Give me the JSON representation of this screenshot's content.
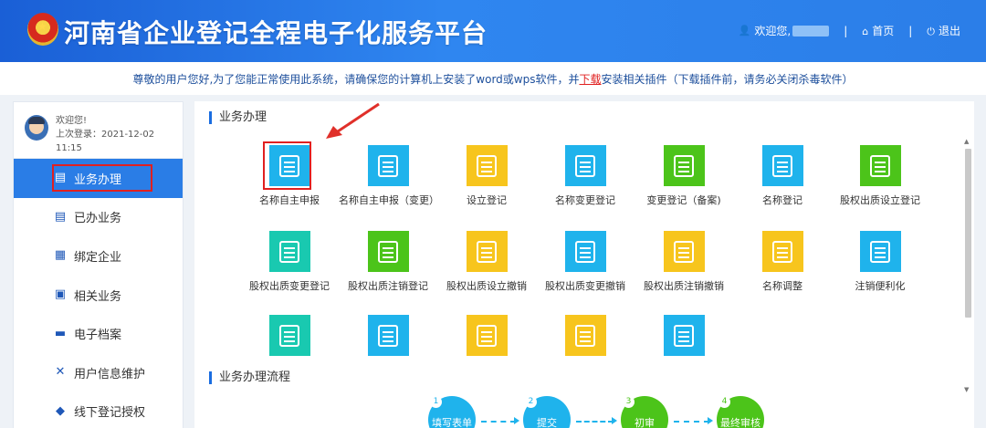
{
  "header": {
    "title": "河南省企业登记全程电子化服务平台",
    "welcome": "欢迎您,",
    "home": "首页",
    "logout": "退出",
    "separator": "|"
  },
  "notice": {
    "prefix": "尊敬的用户您好,为了您能正常使用此系统，请确保您的计算机上安装了word或wps软件，并",
    "link": "下载",
    "suffix": "安装相关插件（下载插件前，请务必关闭杀毒软件）"
  },
  "sidebar": {
    "greeting": "欢迎您!",
    "last_login": "上次登录：2021-12-02 11:15",
    "items": [
      {
        "label": "业务办理",
        "icon": "document-icon"
      },
      {
        "label": "已办业务",
        "icon": "checklist-icon"
      },
      {
        "label": "绑定企业",
        "icon": "building-icon"
      },
      {
        "label": "相关业务",
        "icon": "search-document-icon"
      },
      {
        "label": "电子档案",
        "icon": "archive-icon"
      },
      {
        "label": "用户信息维护",
        "icon": "tools-icon"
      },
      {
        "label": "线下登记授权",
        "icon": "shield-icon"
      }
    ]
  },
  "main": {
    "section_title": "业务办理",
    "flow_title": "业务办理流程",
    "tiles": [
      {
        "label": "名称自主申报",
        "color": "#1fb3ec"
      },
      {
        "label": "名称自主申报（变更）",
        "color": "#1fb3ec"
      },
      {
        "label": "设立登记",
        "color": "#f7c51d"
      },
      {
        "label": "名称变更登记",
        "color": "#1fb3ec"
      },
      {
        "label": "变更登记（备案)",
        "color": "#4cc41a"
      },
      {
        "label": "名称登记",
        "color": "#1fb3ec"
      },
      {
        "label": "股权出质设立登记",
        "color": "#4cc41a"
      },
      {
        "label": "股权出质变更登记",
        "color": "#19c9b0"
      },
      {
        "label": "股权出质注销登记",
        "color": "#4cc41a"
      },
      {
        "label": "股权出质设立撤销",
        "color": "#f7c51d"
      },
      {
        "label": "股权出质变更撤销",
        "color": "#1fb3ec"
      },
      {
        "label": "股权出质注销撤销",
        "color": "#f7c51d"
      },
      {
        "label": "名称调整",
        "color": "#f7c51d"
      },
      {
        "label": "注销便利化",
        "color": "#1fb3ec"
      },
      {
        "label": "",
        "color": "#19c9b0"
      },
      {
        "label": "",
        "color": "#1fb3ec"
      },
      {
        "label": "",
        "color": "#f7c51d"
      },
      {
        "label": "",
        "color": "#f7c51d"
      },
      {
        "label": "",
        "color": "#1fb3ec"
      }
    ],
    "flow": [
      {
        "num": "1",
        "label": "填写表单",
        "color": "#1fb3ec"
      },
      {
        "num": "2",
        "label": "提交",
        "color": "#1fb3ec"
      },
      {
        "num": "3",
        "label": "初审",
        "color": "#4cc41a"
      },
      {
        "num": "4",
        "label": "最终审核",
        "color": "#4cc41a"
      }
    ]
  }
}
